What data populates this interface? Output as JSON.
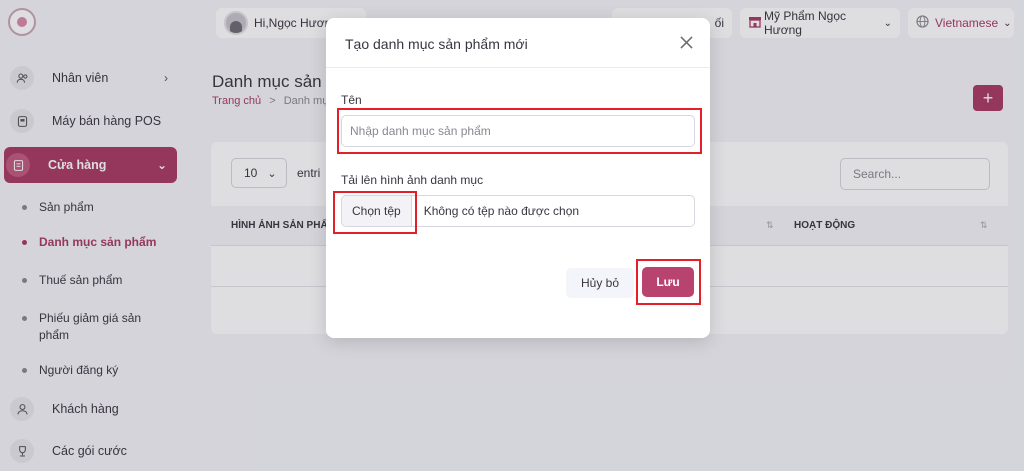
{
  "sidebar": {
    "items": [
      {
        "label": "Nhân viên",
        "icon": "users-icon"
      },
      {
        "label": "Máy bán hàng POS",
        "icon": "pos-icon"
      },
      {
        "label": "Cửa hàng",
        "icon": "store-icon"
      },
      {
        "label": "Khách hàng",
        "icon": "customer-icon"
      },
      {
        "label": "Các gói cước",
        "icon": "trophy-icon"
      }
    ],
    "sub_items": [
      "Sản phẩm",
      "Danh mục sản phẩm",
      "Thuế sản phẩm",
      "Phiếu giảm giá sản phẩm",
      "Người đăng ký"
    ]
  },
  "topbar": {
    "greeting": "Hi,Ngọc Hươn",
    "hidden_item": "ối",
    "store": "Mỹ Phẩm Ngọc Hương",
    "language": "Vietnamese"
  },
  "page": {
    "title": "Danh mục sản p",
    "breadcrumb_home": "Trang chủ",
    "breadcrumb_sep": ">",
    "breadcrumb_current": "Danh mục",
    "add_symbol": "+"
  },
  "table": {
    "entries_value": "10",
    "entries_label": "entri",
    "search_placeholder": "Search...",
    "col_image": "HÌNH ẢNH SẢN PHẨM",
    "col_action": "HOẠT ĐỘNG"
  },
  "modal": {
    "title": "Tạo danh mục sản phẩm mới",
    "name_label": "Tên",
    "name_placeholder": "Nhập danh mục sản phẩm",
    "upload_label": "Tải lên hình ảnh danh mục",
    "choose_file": "Chọn tệp",
    "no_file": "Không có tệp nào được chọn",
    "cancel": "Hủy bỏ",
    "save": "Lưu"
  },
  "colors": {
    "brand": "#a83a64",
    "save_button": "#b8436f",
    "highlight": "#e3202a"
  }
}
